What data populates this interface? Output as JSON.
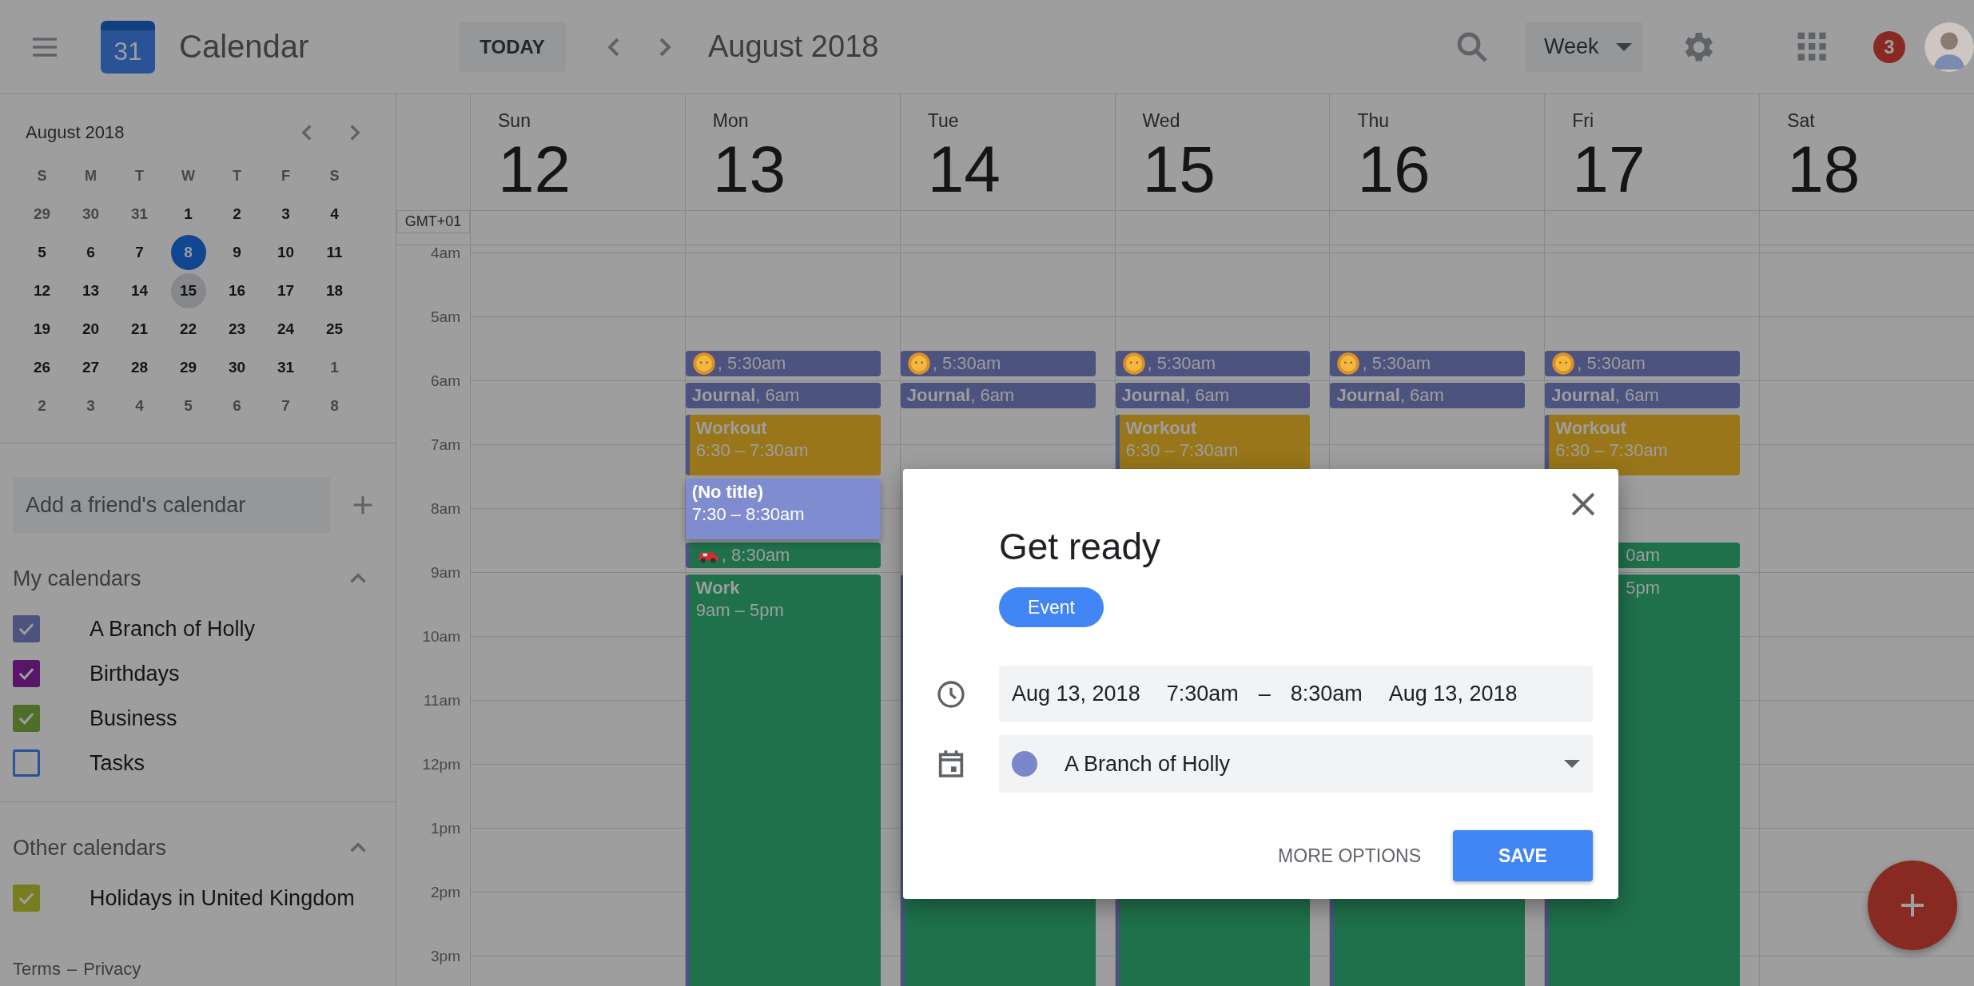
{
  "header": {
    "app_name": "Calendar",
    "logo_text": "31",
    "today_button": "TODAY",
    "period": "August 2018",
    "view_selector": "Week",
    "notification_count": "3"
  },
  "mini_calendar": {
    "month": "August 2018",
    "weekdays": [
      "S",
      "M",
      "T",
      "W",
      "T",
      "F",
      "S"
    ],
    "days": [
      {
        "day": "29",
        "outside": true,
        "today": false,
        "selected": false
      },
      {
        "day": "30",
        "outside": true,
        "today": false,
        "selected": false
      },
      {
        "day": "31",
        "outside": true,
        "today": false,
        "selected": false
      },
      {
        "day": "1",
        "outside": false,
        "today": false,
        "selected": false
      },
      {
        "day": "2",
        "outside": false,
        "today": false,
        "selected": false
      },
      {
        "day": "3",
        "outside": false,
        "today": false,
        "selected": false
      },
      {
        "day": "4",
        "outside": false,
        "today": false,
        "selected": false
      },
      {
        "day": "5",
        "outside": false,
        "today": false,
        "selected": false
      },
      {
        "day": "6",
        "outside": false,
        "today": false,
        "selected": false
      },
      {
        "day": "7",
        "outside": false,
        "today": false,
        "selected": false
      },
      {
        "day": "8",
        "outside": false,
        "today": true,
        "selected": false
      },
      {
        "day": "9",
        "outside": false,
        "today": false,
        "selected": false
      },
      {
        "day": "10",
        "outside": false,
        "today": false,
        "selected": false
      },
      {
        "day": "11",
        "outside": false,
        "today": false,
        "selected": false
      },
      {
        "day": "12",
        "outside": false,
        "today": false,
        "selected": false
      },
      {
        "day": "13",
        "outside": false,
        "today": false,
        "selected": false
      },
      {
        "day": "14",
        "outside": false,
        "today": false,
        "selected": false
      },
      {
        "day": "15",
        "outside": false,
        "today": false,
        "selected": true
      },
      {
        "day": "16",
        "outside": false,
        "today": false,
        "selected": false
      },
      {
        "day": "17",
        "outside": false,
        "today": false,
        "selected": false
      },
      {
        "day": "18",
        "outside": false,
        "today": false,
        "selected": false
      },
      {
        "day": "19",
        "outside": false,
        "today": false,
        "selected": false
      },
      {
        "day": "20",
        "outside": false,
        "today": false,
        "selected": false
      },
      {
        "day": "21",
        "outside": false,
        "today": false,
        "selected": false
      },
      {
        "day": "22",
        "outside": false,
        "today": false,
        "selected": false
      },
      {
        "day": "23",
        "outside": false,
        "today": false,
        "selected": false
      },
      {
        "day": "24",
        "outside": false,
        "today": false,
        "selected": false
      },
      {
        "day": "25",
        "outside": false,
        "today": false,
        "selected": false
      },
      {
        "day": "26",
        "outside": false,
        "today": false,
        "selected": false
      },
      {
        "day": "27",
        "outside": false,
        "today": false,
        "selected": false
      },
      {
        "day": "28",
        "outside": false,
        "today": false,
        "selected": false
      },
      {
        "day": "29",
        "outside": false,
        "today": false,
        "selected": false
      },
      {
        "day": "30",
        "outside": false,
        "today": false,
        "selected": false
      },
      {
        "day": "31",
        "outside": false,
        "today": false,
        "selected": false
      },
      {
        "day": "1",
        "outside": true,
        "today": false,
        "selected": false
      },
      {
        "day": "2",
        "outside": true,
        "today": false,
        "selected": false
      },
      {
        "day": "3",
        "outside": true,
        "today": false,
        "selected": false
      },
      {
        "day": "4",
        "outside": true,
        "today": false,
        "selected": false
      },
      {
        "day": "5",
        "outside": true,
        "today": false,
        "selected": false
      },
      {
        "day": "6",
        "outside": true,
        "today": false,
        "selected": false
      },
      {
        "day": "7",
        "outside": true,
        "today": false,
        "selected": false
      },
      {
        "day": "8",
        "outside": true,
        "today": false,
        "selected": false
      }
    ]
  },
  "add_calendar": {
    "placeholder": "Add a friend's calendar"
  },
  "my_calendars": {
    "title": "My calendars",
    "expanded": true,
    "items": [
      {
        "name": "A Branch of Holly",
        "color": "#4b537e",
        "checked": true
      },
      {
        "name": "Birthdays",
        "color": "#581669",
        "checked": true
      },
      {
        "name": "Business",
        "color": "#4d6f29",
        "checked": true
      },
      {
        "name": "Tasks",
        "color": "#295297",
        "checked": false
      }
    ]
  },
  "other_calendars": {
    "title": "Other calendars",
    "expanded": true,
    "items": [
      {
        "name": "Holidays in United Kingdom",
        "color": "#777d20",
        "checked": true
      }
    ]
  },
  "footer": {
    "links": [
      "Terms",
      "Privacy"
    ],
    "separator": "–"
  },
  "timezone": "GMT+01",
  "hours": [
    "4am",
    "5am",
    "6am",
    "7am",
    "8am",
    "9am",
    "10am",
    "11am",
    "12pm",
    "1pm",
    "2pm",
    "3pm"
  ],
  "days": [
    {
      "weekday": "Sun",
      "date": "12"
    },
    {
      "weekday": "Mon",
      "date": "13",
      "events": [
        {
          "kind": "sunrise",
          "covered": false,
          "text": ", 5:30am"
        },
        {
          "kind": "journal",
          "covered": false,
          "text": "**Journal**, 6am"
        },
        {
          "kind": "workout",
          "covered": false,
          "title": "Workout",
          "time": "6:30 – 7:30am"
        },
        {
          "kind": "draft",
          "covered": false,
          "title": "(No title)",
          "time": "7:30 – 8:30am"
        },
        {
          "kind": "commute",
          "covered": false,
          "text": ", 8:30am"
        },
        {
          "kind": "work",
          "covered": false,
          "title": "Work",
          "time": "9am – 5pm"
        }
      ]
    },
    {
      "weekday": "Tue",
      "date": "14",
      "events": [
        {
          "kind": "sunrise",
          "covered": false,
          "text": ", 5:30am"
        },
        {
          "kind": "journal",
          "covered": false,
          "text": "**Journal**, 6am"
        },
        {
          "kind": "work"
        }
      ]
    },
    {
      "weekday": "Wed",
      "date": "15",
      "events": [
        {
          "kind": "sunrise",
          "covered": false,
          "text": ", 5:30am"
        },
        {
          "kind": "journal",
          "covered": false,
          "text": "**Journal**, 6am"
        },
        {
          "kind": "workout",
          "covered": false,
          "title": "Workout",
          "time": "6:30 – 7:30am"
        },
        {
          "kind": "work"
        }
      ]
    },
    {
      "weekday": "Thu",
      "date": "16",
      "events": [
        {
          "kind": "sunrise",
          "covered": false,
          "text": ", 5:30am"
        },
        {
          "kind": "journal",
          "covered": false,
          "text": "**Journal**, 6am"
        },
        {
          "kind": "work"
        }
      ]
    },
    {
      "weekday": "Fri",
      "date": "17",
      "events": [
        {
          "kind": "sunrise",
          "covered": false,
          "text": ", 5:30am"
        },
        {
          "kind": "journal",
          "covered": false,
          "text": "**Journal**, 6am"
        },
        {
          "kind": "workout",
          "covered": false,
          "title": "Workout",
          "time": "6:30 – 7:30am"
        },
        {
          "kind": "commute",
          "covered": true,
          "text": "0am"
        },
        {
          "kind": "work",
          "covered": true,
          "time": "5pm"
        }
      ]
    },
    {
      "weekday": "Sat",
      "date": "18"
    }
  ],
  "dialog": {
    "title": "Get ready",
    "type_chip": "Event",
    "start_date": "Aug 13, 2018",
    "start_time": "7:30am",
    "dash": "–",
    "end_time": "8:30am",
    "end_date": "Aug 13, 2018",
    "calendar": {
      "name": "A Branch of Holly",
      "color": "#7986cb"
    },
    "more_button": "MORE OPTIONS",
    "save_button": "SAVE"
  }
}
